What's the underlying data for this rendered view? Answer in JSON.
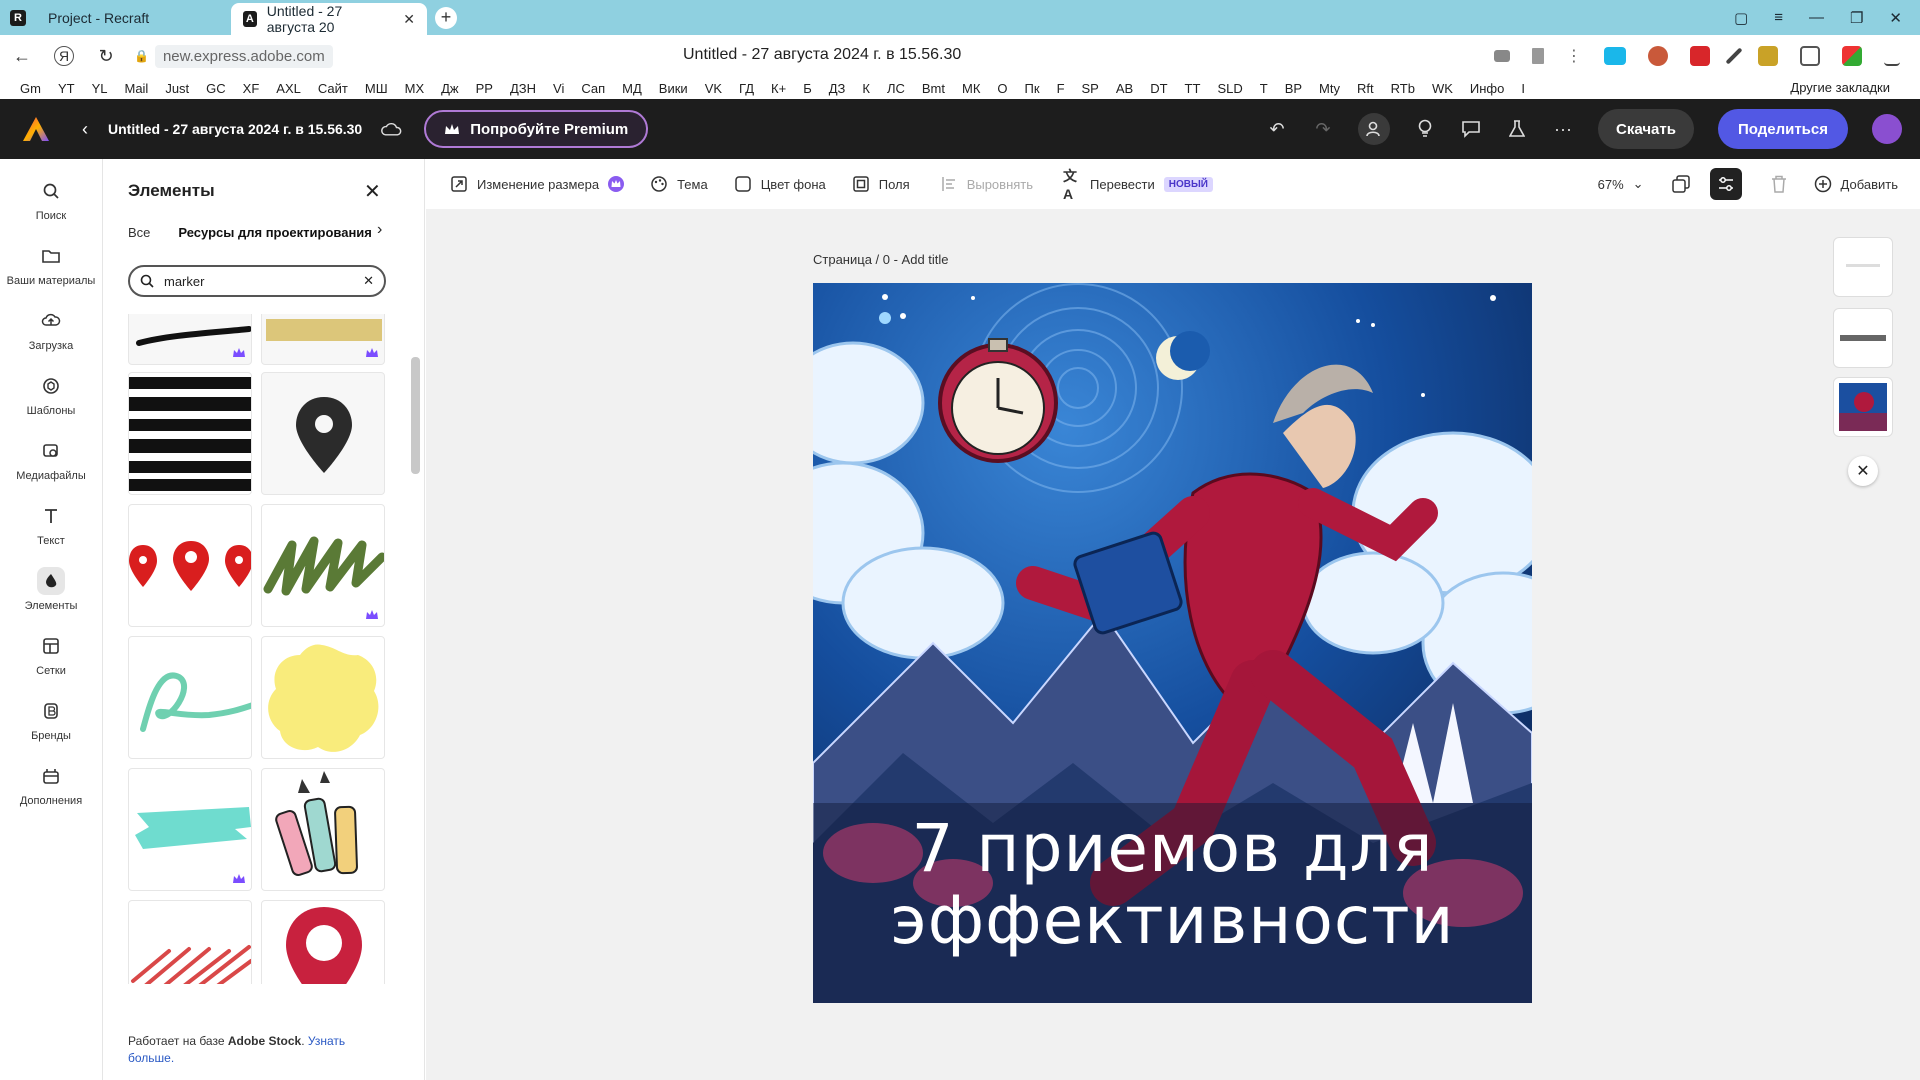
{
  "browser": {
    "tabs": [
      {
        "title": "Project - Recraft",
        "active": false
      },
      {
        "title": "Untitled - 27 августа 20",
        "active": true
      }
    ],
    "url": "new.express.adobe.com",
    "page_title": "Untitled - 27 августа 2024 г. в 15.56.30",
    "bookmarks": [
      "Gm",
      "YT",
      "YL",
      "Mail",
      "Just",
      "GC",
      "XF",
      "AXL",
      "Сайт",
      "МШ",
      "МХ",
      "Дж",
      "РР",
      "ДЗН",
      "Vi",
      "Сап",
      "МД",
      "Вики",
      "VK",
      "ГД",
      "К+",
      "Б",
      "ДЗ",
      "К",
      "ЛС",
      "Bmt",
      "МК",
      "О",
      "Пк",
      "F",
      "SP",
      "AB",
      "DT",
      "TT",
      "SLD",
      "T",
      "BP",
      "Mty",
      "Rft",
      "RTb",
      "WK",
      "Инфо",
      "I"
    ],
    "other_bookmarks": "Другие закладки"
  },
  "app": {
    "doc_title": "Untitled - 27 августа 2024 г. в 15.56.30",
    "premium_label": "Попробуйте Premium",
    "download_label": "Скачать",
    "share_label": "Поделиться"
  },
  "rail": [
    {
      "label": "Поиск",
      "icon": "search-icon"
    },
    {
      "label": "Ваши материалы",
      "icon": "folder-icon"
    },
    {
      "label": "Загрузка",
      "icon": "upload-icon"
    },
    {
      "label": "Шаблоны",
      "icon": "templates-icon"
    },
    {
      "label": "Медиафайлы",
      "icon": "media-icon"
    },
    {
      "label": "Текст",
      "icon": "text-icon"
    },
    {
      "label": "Элементы",
      "icon": "elements-icon",
      "active": true
    },
    {
      "label": "Сетки",
      "icon": "grids-icon"
    },
    {
      "label": "Бренды",
      "icon": "brands-icon"
    },
    {
      "label": "Дополнения",
      "icon": "addons-icon"
    }
  ],
  "panel": {
    "title": "Элементы",
    "tabs": [
      "Все",
      "Ресурсы для проектирования"
    ],
    "search_value": "marker",
    "footer_text": "Работает на базе ",
    "footer_brand": "Adobe Stock",
    "footer_link": "Узнать больше."
  },
  "toolbar": {
    "resize": "Изменение размера",
    "theme": "Тема",
    "bg_color": "Цвет фона",
    "margins": "Поля",
    "align": "Выровнять",
    "translate": "Перевести",
    "new_badge": "НОВЫЙ",
    "zoom": "67%",
    "add": "Добавить"
  },
  "canvas": {
    "page_label": "Страница / 0 - Add title",
    "headline_line1": "7 приемов для",
    "headline_line2": "эффективности"
  },
  "colors": {
    "accent_share": "#5258e4",
    "header_bg": "#1d1d1d",
    "premium_border": "#b07ad6",
    "tab_strip": "#8fd0e0"
  }
}
